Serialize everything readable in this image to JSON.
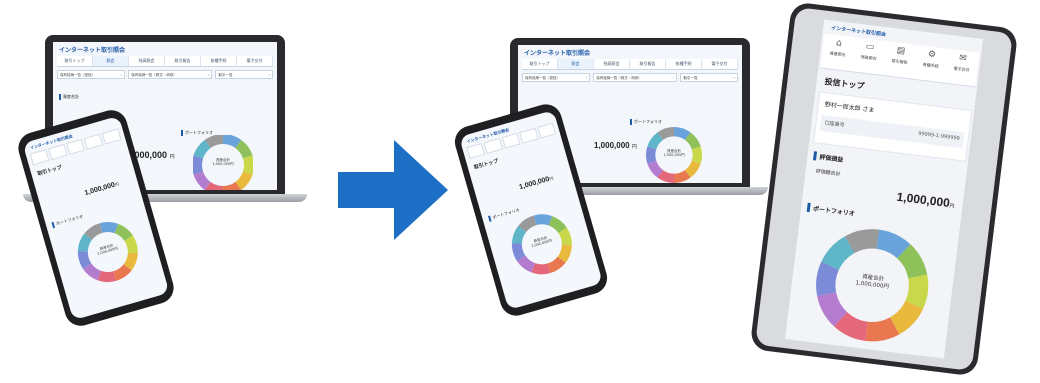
{
  "app": {
    "title": "インターネット取引照会"
  },
  "laptop_before": {
    "tabs": [
      {
        "label": "取引トップ"
      },
      {
        "label": "照会"
      },
      {
        "label": "残高照会"
      },
      {
        "label": "取引報告"
      },
      {
        "label": "各種手続"
      },
      {
        "label": "電子交付"
      }
    ],
    "selects": [
      {
        "label": "保有銘柄一覧（投信）"
      },
      {
        "label": "保有銘柄一覧（株式・債券）"
      },
      {
        "label": "取引一覧"
      }
    ],
    "section_label": "資産合計",
    "portfolio_label": "ポートフォリオ",
    "amount": "1,000,000",
    "unit": "円",
    "donut_center_line1": "資産合計",
    "donut_center_line2": "1,000,000円"
  },
  "phone_left": {
    "screen_label": "取引トップ",
    "amount": "1,000,000",
    "unit": "円",
    "portfolio_label": "ポートフォリオ",
    "donut_center_line1": "資産合計",
    "donut_center_line2": "1,000,000円"
  },
  "laptop_after": {
    "tabs": [
      {
        "label": "取引トップ"
      },
      {
        "label": "照会"
      },
      {
        "label": "残高照会"
      },
      {
        "label": "取引報告"
      },
      {
        "label": "各種手続"
      },
      {
        "label": "電子交付"
      }
    ],
    "selects": [
      {
        "label": "保有銘柄一覧（投信）"
      },
      {
        "label": "保有銘柄一覧（株式・債券）"
      },
      {
        "label": "取引一覧"
      }
    ],
    "portfolio_label": "ポートフォリオ",
    "amount": "1,000,000",
    "unit": "円",
    "donut_center_line1": "資産合計",
    "donut_center_line2": "1,000,000円"
  },
  "phone_right": {
    "screen_label": "取引トップ",
    "amount": "1,000,000",
    "unit": "円",
    "portfolio_label": "ポートフォリオ",
    "donut_center_line1": "資産合計",
    "donut_center_line2": "1,000,000円"
  },
  "tablet": {
    "title": "インターネット取引照会",
    "nav": [
      {
        "label": "資産照会",
        "icon": "bank-icon"
      },
      {
        "label": "残高照会",
        "icon": "wallet-icon"
      },
      {
        "label": "取引報告",
        "icon": "report-icon"
      },
      {
        "label": "各種手続",
        "icon": "settings-icon"
      },
      {
        "label": "電子交付",
        "icon": "document-icon"
      }
    ],
    "page_title": "投信トップ",
    "customer_name": "野村一郎太郎",
    "customer_suffix": "さま",
    "account_label": "口座番号",
    "account_number": "99999-1-999999",
    "section_valuation": "評価損益",
    "valuation_label": "評価額合計",
    "amount": "1,000,000",
    "unit": "円",
    "portfolio_label": "ポートフォリオ",
    "donut_center_line1": "資産合計",
    "donut_center_line2": "1,000,000円"
  },
  "chart_data": {
    "type": "pie",
    "style": "donut",
    "segment_colors": [
      "#6aa3dc",
      "#8fc15a",
      "#c8d84a",
      "#e8b93c",
      "#e9774f",
      "#e4677a",
      "#b47ccf",
      "#7c8bd8",
      "#5fb6c9",
      "#9a9a9a"
    ],
    "values": [
      10,
      10,
      10,
      10,
      10,
      10,
      10,
      10,
      10,
      10
    ]
  },
  "arrow": {
    "color": "#1d6fc6"
  }
}
